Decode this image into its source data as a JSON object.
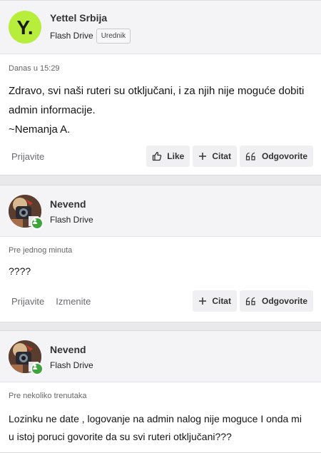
{
  "posts": [
    {
      "author": "Yettel Srbija",
      "avatar_letter": "Y.",
      "rank": "Flash Drive",
      "badge": "Urednik",
      "time": "Danas u 15:29",
      "body": [
        "Zdravo, svi naši ruteri su otključani, i za njih nije moguće dobiti",
        "admin informacije.",
        "~Nemanja A."
      ],
      "links": [
        "Prijavite"
      ],
      "buttons": {
        "like": "Like",
        "quote": "Citat",
        "reply": "Odgovorite"
      }
    },
    {
      "author": "Nevend",
      "rank": "Flash Drive",
      "time": "Pre jednog minuta",
      "body": [
        "????"
      ],
      "links": [
        "Prijavite",
        "Izmenite"
      ],
      "buttons": {
        "quote": "Citat",
        "reply": "Odgovorite"
      }
    },
    {
      "author": "Nevend",
      "rank": "Flash Drive",
      "time": "Pre nekoliko trenutaka",
      "body": [
        "Lozinku ne date , logovanje na admin nalog nije moguce I onda mi",
        "u istoj poruci govorite da su svi ruteri otključani???"
      ]
    }
  ],
  "colors": {
    "online": "#3ca63c",
    "yettel_green": "#b7ee3b"
  }
}
